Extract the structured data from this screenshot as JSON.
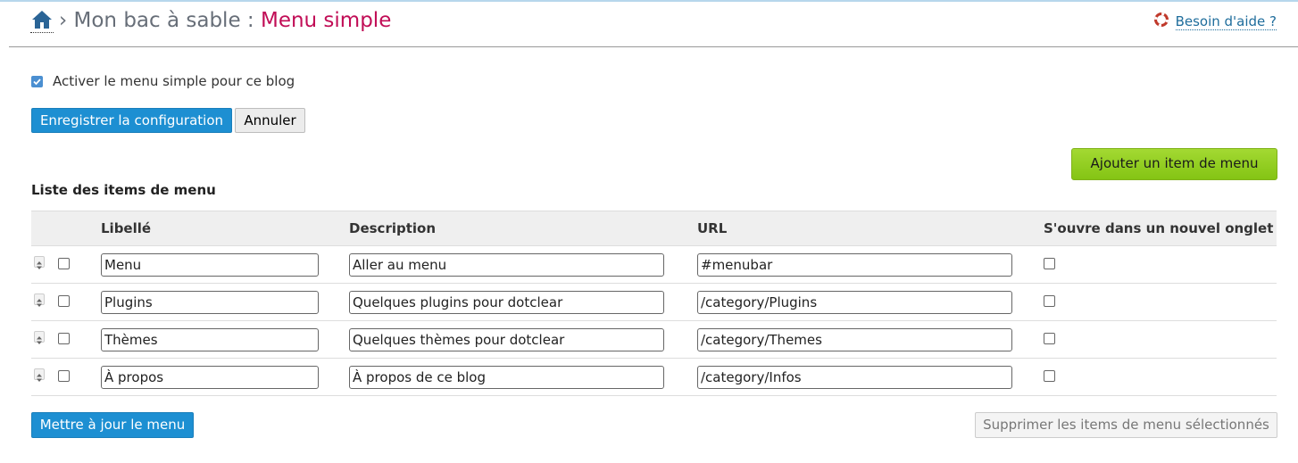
{
  "breadcrumb": {
    "home_icon": "home-icon",
    "separator": "›",
    "blog": "Mon bac à sable :",
    "page": "Menu simple"
  },
  "help": {
    "label": "Besoin d'aide ?",
    "icon": "lifebuoy-icon"
  },
  "settings": {
    "activate_label": "Activer le menu simple pour ce blog",
    "activate_checked": true,
    "save_label": "Enregistrer la configuration",
    "cancel_label": "Annuler"
  },
  "add_item_label": "Ajouter un item de menu",
  "list_title": "Liste des items de menu",
  "table": {
    "headers": [
      "Libellé",
      "Description",
      "URL",
      "S'ouvre dans un nouvel onglet"
    ],
    "rows": [
      {
        "label": "Menu",
        "description": "Aller au menu",
        "url": "#menubar"
      },
      {
        "label": "Plugins",
        "description": "Quelques plugins pour dotclear",
        "url": "/category/Plugins"
      },
      {
        "label": "Thèmes",
        "description": "Quelques thèmes pour dotclear",
        "url": "/category/Themes"
      },
      {
        "label": "À propos",
        "description": "À propos de ce blog",
        "url": "/category/Infos"
      }
    ]
  },
  "footer": {
    "update_label": "Mettre à jour le menu",
    "delete_label": "Supprimer les items de menu sélectionnés"
  },
  "colors": {
    "accent_blue": "#1d8fd2",
    "page_title": "#c10d56",
    "add_green": "#96d41c",
    "help_link": "#1f6d9c"
  }
}
